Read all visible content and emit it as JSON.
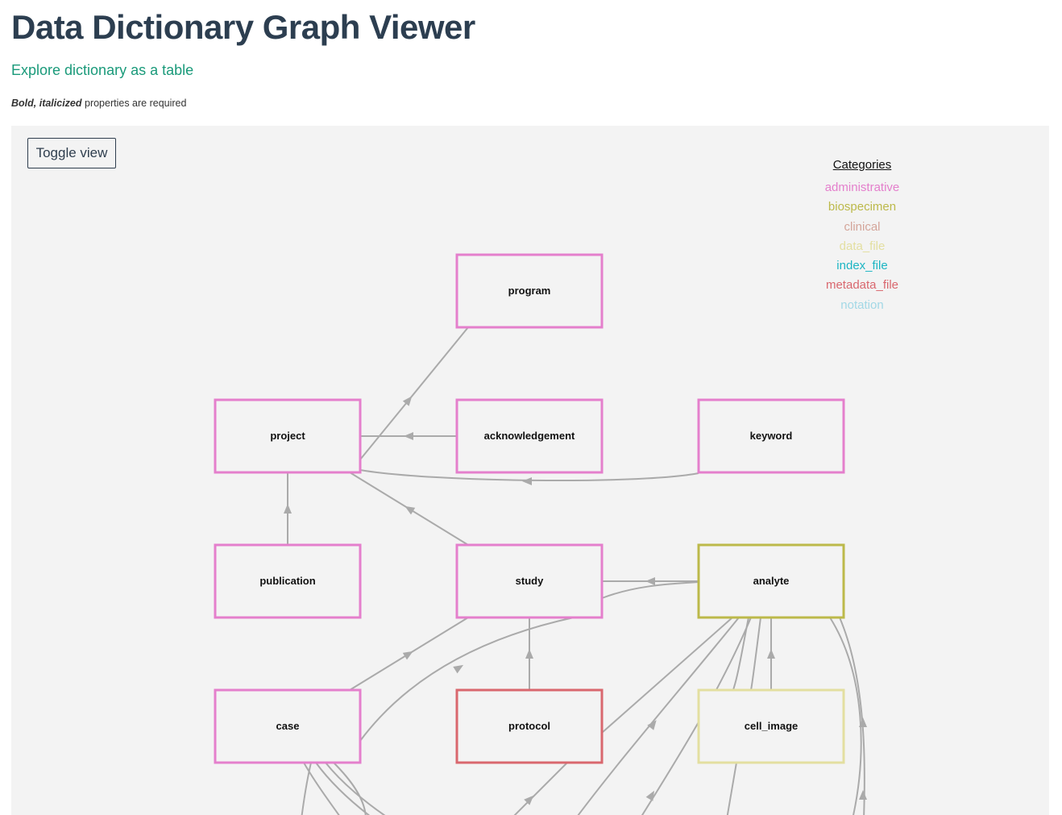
{
  "header": {
    "title": "Data Dictionary Graph Viewer",
    "table_link": "Explore dictionary as a table",
    "required_note_bold": "Bold, italicized",
    "required_note_rest": " properties are required"
  },
  "graph": {
    "toggle_label": "Toggle view",
    "legend_title": "Categories",
    "categories": [
      {
        "name": "administrative",
        "color": "#e47fcc"
      },
      {
        "name": "biospecimen",
        "color": "#bcb94a"
      },
      {
        "name": "clinical",
        "color": "#d4a59a"
      },
      {
        "name": "data_file",
        "color": "#e3dfa0"
      },
      {
        "name": "index_file",
        "color": "#1cb5c3"
      },
      {
        "name": "metadata_file",
        "color": "#d9676e"
      },
      {
        "name": "notation",
        "color": "#a3d8e6"
      }
    ],
    "nodes": [
      {
        "id": "program",
        "label": "program",
        "category": "administrative"
      },
      {
        "id": "project",
        "label": "project",
        "category": "administrative"
      },
      {
        "id": "acknowledgement",
        "label": "acknowledgement",
        "category": "administrative"
      },
      {
        "id": "keyword",
        "label": "keyword",
        "category": "administrative"
      },
      {
        "id": "publication",
        "label": "publication",
        "category": "administrative"
      },
      {
        "id": "study",
        "label": "study",
        "category": "administrative"
      },
      {
        "id": "analyte",
        "label": "analyte",
        "category": "biospecimen"
      },
      {
        "id": "case",
        "label": "case",
        "category": "administrative"
      },
      {
        "id": "protocol",
        "label": "protocol",
        "category": "metadata_file"
      },
      {
        "id": "cell_image",
        "label": "cell_image",
        "category": "data_file"
      }
    ],
    "edges": [
      {
        "from": "project",
        "to": "program"
      },
      {
        "from": "acknowledgement",
        "to": "project"
      },
      {
        "from": "keyword",
        "to": "project"
      },
      {
        "from": "publication",
        "to": "project"
      },
      {
        "from": "study",
        "to": "project"
      },
      {
        "from": "analyte",
        "to": "study"
      },
      {
        "from": "case",
        "to": "study"
      },
      {
        "from": "protocol",
        "to": "study"
      },
      {
        "from": "cell_image",
        "to": "analyte"
      }
    ]
  }
}
